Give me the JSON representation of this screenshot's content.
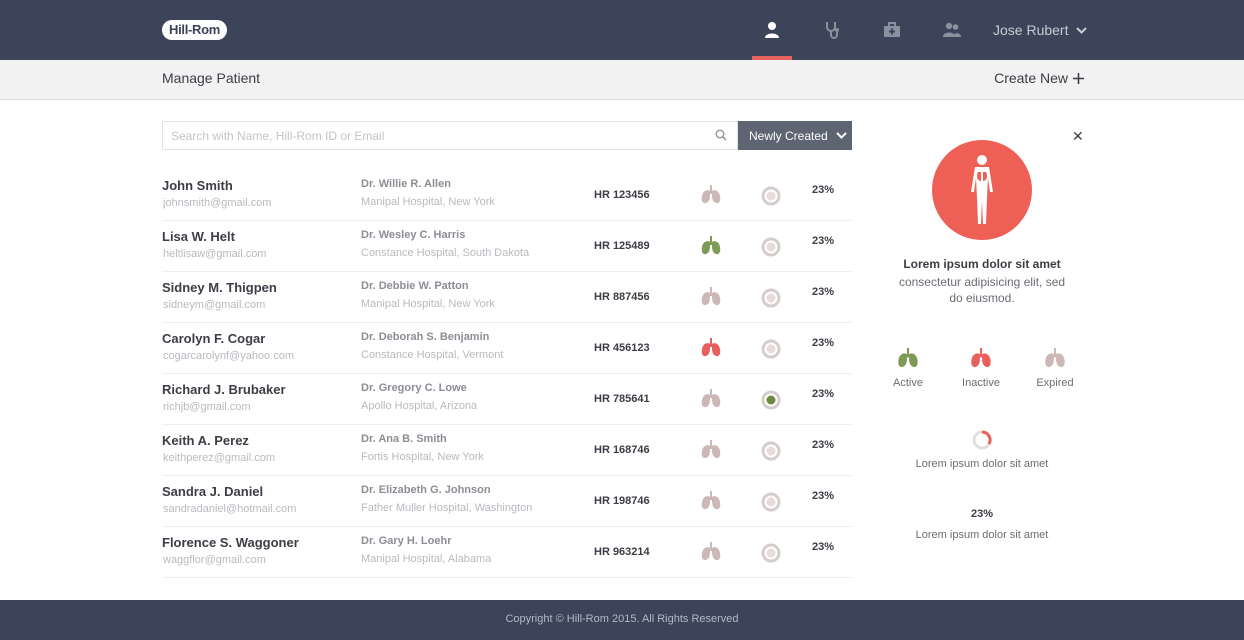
{
  "brand": {
    "logo": "Hill-Rom",
    "accent": "#e8605c",
    "header_bg": "#3b4458"
  },
  "nav": {
    "icons": [
      "patient-icon",
      "stethoscope-icon",
      "medical-kit-icon",
      "users-icon"
    ],
    "active": "patient-icon",
    "user_name": "Jose Rubert"
  },
  "subheader": {
    "title": "Manage Patient",
    "create_label": "Create New"
  },
  "search": {
    "placeholder": "Search with Name, Hill-Rom ID or Email",
    "value": ""
  },
  "sort": {
    "selected": "Newly Created"
  },
  "patients": [
    {
      "name": "John Smith",
      "email": "johnsmith@gmail.com",
      "doctor": "Dr. Willie R. Allen",
      "hospital": "Manipal Hospital, New York",
      "hr_id": "HR 123456",
      "lung_status": "expired",
      "ring_state": "default",
      "percent": "23%",
      "progress": 0.23
    },
    {
      "name": "Lisa W. Helt",
      "email": "heltlisaw@gmail.com",
      "doctor": "Dr. Wesley C. Harris",
      "hospital": "Constance Hospital, South Dakota",
      "hr_id": "HR 125489",
      "lung_status": "active",
      "ring_state": "default",
      "percent": "23%",
      "progress": 0.23
    },
    {
      "name": "Sidney M. Thigpen",
      "email": "sidneym@gmail.com",
      "doctor": "Dr. Debbie W. Patton",
      "hospital": "Manipal Hospital, New York",
      "hr_id": "HR 887456",
      "lung_status": "expired",
      "ring_state": "default",
      "percent": "23%",
      "progress": 0.23
    },
    {
      "name": "Carolyn F. Cogar",
      "email": "cogarcarolynf@yahoo.com",
      "doctor": "Dr. Deborah S. Benjamin",
      "hospital": "Constance Hospital, Vermont",
      "hr_id": "HR 456123",
      "lung_status": "inactive",
      "ring_state": "default",
      "percent": "23%",
      "progress": 0.23
    },
    {
      "name": "Richard J. Brubaker",
      "email": "richjb@gmail.com",
      "doctor": "Dr. Gregory C. Lowe",
      "hospital": "Apollo Hospital, Arizona",
      "hr_id": "HR 785641",
      "lung_status": "expired",
      "ring_state": "green",
      "percent": "23%",
      "progress": 0.23
    },
    {
      "name": "Keith A. Perez",
      "email": "keithperez@gmail.com",
      "doctor": "Dr. Ana B. Smith",
      "hospital": "Fortis Hospital, New York",
      "hr_id": "HR 168746",
      "lung_status": "expired",
      "ring_state": "default",
      "percent": "23%",
      "progress": 0.23
    },
    {
      "name": "Sandra J. Daniel",
      "email": "sandradaniel@hotmail.com",
      "doctor": "Dr. Elizabeth G. Johnson",
      "hospital": "Father Muller Hospital, Washington",
      "hr_id": "HR 198746",
      "lung_status": "expired",
      "ring_state": "default",
      "percent": "23%",
      "progress": 0.23
    },
    {
      "name": "Florence S. Waggoner",
      "email": "waggflor@gmail.com",
      "doctor": "Dr. Gary H. Loehr",
      "hospital": "Manipal Hospital, Alabama",
      "hr_id": "HR 963214",
      "lung_status": "expired",
      "ring_state": "default",
      "percent": "23%",
      "progress": 0.23
    }
  ],
  "lung_colors": {
    "active": "#7d9a57",
    "inactive": "#e8605c",
    "expired": "#cdb8b8"
  },
  "panel": {
    "close": "✕",
    "title": "Lorem ipsum dolor sit amet",
    "description": "consectetur adipisicing elit, sed do eiusmod.",
    "legend": [
      {
        "status": "active",
        "label": "Active"
      },
      {
        "status": "inactive",
        "label": "Inactive"
      },
      {
        "status": "expired",
        "label": "Expired"
      }
    ],
    "stat1_text": "Lorem ipsum dolor sit amet",
    "stat2_percent": "23%",
    "stat2_progress": 0.23,
    "stat2_text": "Lorem ipsum dolor sit amet"
  },
  "footer": {
    "copyright": "Copyright © Hill-Rom 2015. All Rights Reserved"
  }
}
